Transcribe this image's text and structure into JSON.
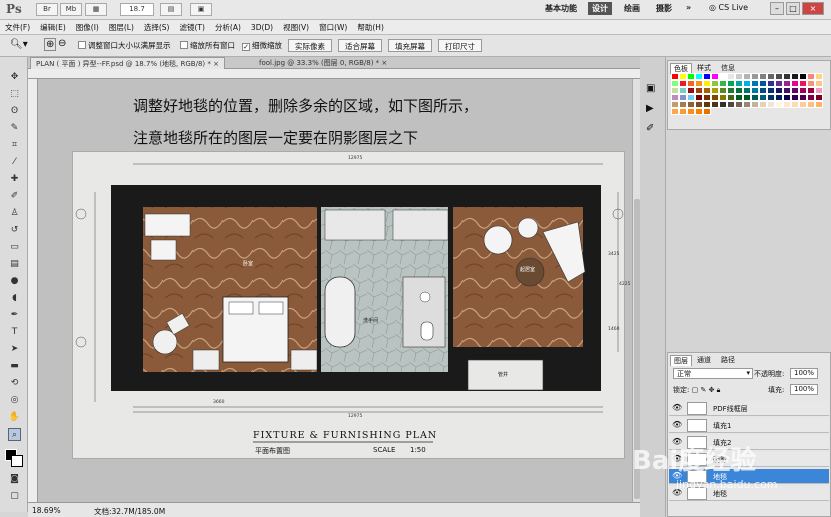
{
  "app": {
    "logo": "Ps",
    "zoom_field": "18.7",
    "workspaces": [
      "基本功能",
      "设计",
      "绘画",
      "摄影"
    ],
    "active_workspace": "设计",
    "cs_live": "CS Live",
    "more": "»"
  },
  "menu": [
    "文件(F)",
    "编辑(E)",
    "图像(I)",
    "图层(L)",
    "选择(S)",
    "滤镜(T)",
    "分析(A)",
    "3D(D)",
    "视图(V)",
    "窗口(W)",
    "帮助(H)"
  ],
  "options": {
    "resize_windows": "调整窗口大小以满屏显示",
    "zoom_all": "缩放所有窗口",
    "scrubby_zoom": "细微缩放",
    "scrubby_checked": true,
    "actual_pixels": "实际像素",
    "fit_screen": "适合屏幕",
    "fill_screen": "填充屏幕",
    "print_size": "打印尺寸"
  },
  "tabs": [
    {
      "label": "PLAN ( 平面 ) 异型--FF.psd @ 18.7% (地毯, RGB/8) *",
      "close": "×"
    },
    {
      "label": "fool.jpg @ 33.3% (图层 0, RGB/8) *",
      "close": "×"
    }
  ],
  "canvas": {
    "caption_line1": "调整好地毯的位置，删除多余的区域，如下图所示，",
    "caption_line2": "注意地毯所在的图层一定要在阴影图层之下",
    "plan_title": "FIXTURE  &  FURNISHING  PLAN",
    "plan_subtitle": "平面布置图",
    "scale_label": "SCALE",
    "scale_value": "1:50",
    "room_labels": [
      "卧室",
      "洗手间",
      "起居室",
      "管井"
    ],
    "dims": [
      "12975",
      "12975",
      "3660",
      "3425",
      "4225",
      "1460"
    ]
  },
  "status": {
    "zoom": "18.69%",
    "doc": "文档:32.7M/185.0M"
  },
  "swatches": {
    "tabs": [
      "色板",
      "样式",
      "信息"
    ],
    "colors": [
      "#ff0000",
      "#ffff00",
      "#00ff00",
      "#00ffff",
      "#0000ff",
      "#ff00ff",
      "#ffffff",
      "#e6e6e6",
      "#cccccc",
      "#b3b3b3",
      "#999999",
      "#808080",
      "#666666",
      "#4d4d4d",
      "#333333",
      "#1a1a1a",
      "#000000",
      "#ff8080",
      "#ffd480",
      "#80ff80",
      "#ed1c24",
      "#f26522",
      "#f7941d",
      "#fff200",
      "#8dc63f",
      "#39b54a",
      "#00a651",
      "#00a99d",
      "#00aeef",
      "#0072bc",
      "#0054a6",
      "#2e3192",
      "#662d91",
      "#92278f",
      "#ec008c",
      "#ed145b",
      "#f69679",
      "#fdc689",
      "#c4df9b",
      "#7accc8",
      "#9e0b0f",
      "#a0410d",
      "#a36209",
      "#aba000",
      "#598527",
      "#1a7b30",
      "#007236",
      "#00746b",
      "#0076a3",
      "#004b80",
      "#003471",
      "#1b1464",
      "#440e62",
      "#630460",
      "#9e005d",
      "#9e0039",
      "#f49ac1",
      "#bd8cbf",
      "#8493ca",
      "#6dcff6",
      "#790000",
      "#7b2e00",
      "#7d4900",
      "#827b00",
      "#406618",
      "#005e20",
      "#005826",
      "#005952",
      "#005b7f",
      "#003663",
      "#002157",
      "#0d004c",
      "#32004b",
      "#4b0049",
      "#7b0046",
      "#7a0026",
      "#c69c6d",
      "#a67c52",
      "#8c6239",
      "#754c24",
      "#603913",
      "#4d3319",
      "#362f2d",
      "#534741",
      "#736357",
      "#998675",
      "#c7b299",
      "#e5d2b1",
      "#f0e6d2",
      "#fff5e1",
      "#ffe6cc",
      "#ffd9b3",
      "#ffcc99",
      "#ffbf80",
      "#ffb366",
      "#ffa64d",
      "#ff9933",
      "#ff8c1a",
      "#ff8000",
      "#e67300"
    ]
  },
  "layers": {
    "tabs": [
      "图层",
      "通道",
      "路径"
    ],
    "blend_mode": "正常",
    "opacity_label": "不透明度:",
    "opacity": "100%",
    "lock_label": "锁定:",
    "fill_label": "填充:",
    "fill": "100%",
    "rows": [
      {
        "name": "PDF线框层",
        "selected": false
      },
      {
        "name": "填充1",
        "selected": false
      },
      {
        "name": "填充2",
        "selected": false
      },
      {
        "name": "阴影",
        "selected": false
      },
      {
        "name": "地毯",
        "selected": true
      },
      {
        "name": "地毯",
        "selected": false
      }
    ],
    "fx": "fx"
  },
  "watermark": {
    "text": "Bai度经验",
    "url": "jingyan.baidu.com"
  }
}
